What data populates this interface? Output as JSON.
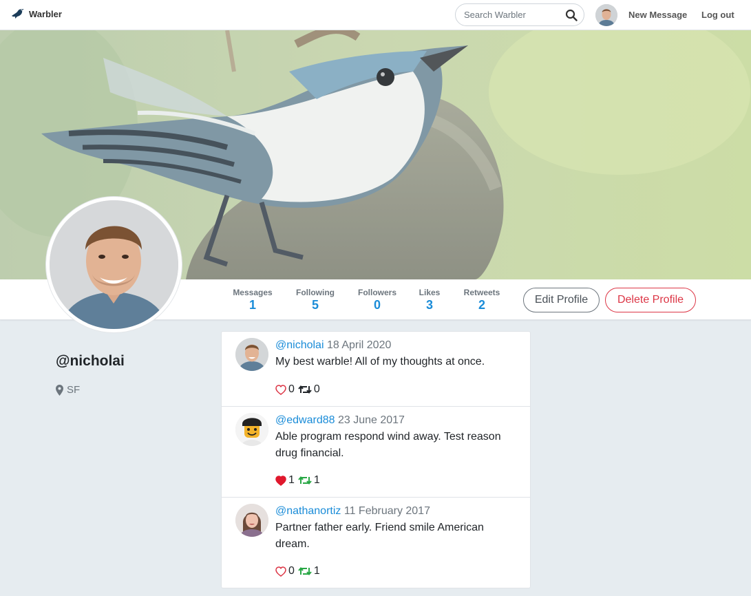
{
  "navbar": {
    "brand": "Warbler",
    "search_placeholder": "Search Warbler",
    "new_message": "New Message",
    "logout": "Log out"
  },
  "profile": {
    "username": "@nicholai",
    "location": "SF"
  },
  "stats": [
    {
      "label": "Messages",
      "value": "1"
    },
    {
      "label": "Following",
      "value": "5"
    },
    {
      "label": "Followers",
      "value": "0"
    },
    {
      "label": "Likes",
      "value": "3"
    },
    {
      "label": "Retweets",
      "value": "2"
    }
  ],
  "buttons": {
    "edit": "Edit Profile",
    "delete": "Delete Profile"
  },
  "messages": [
    {
      "user": "@nicholai",
      "date": "18 April 2020",
      "text": "My best warble! All of my thoughts at once.",
      "likes": "0",
      "retweets": "0",
      "liked": false,
      "retweeted": false
    },
    {
      "user": "@edward88",
      "date": "23 June 2017",
      "text": "Able program respond wind away. Test reason drug financial.",
      "likes": "1",
      "retweets": "1",
      "liked": true,
      "retweeted": true
    },
    {
      "user": "@nathanortiz",
      "date": "11 February 2017",
      "text": "Partner father early. Friend smile American dream.",
      "likes": "0",
      "retweets": "1",
      "liked": false,
      "retweeted": true
    }
  ],
  "colors": {
    "link": "#1a8cd8",
    "danger": "#dc3545",
    "like": "#e0245e",
    "retweet": "#17bf63"
  }
}
